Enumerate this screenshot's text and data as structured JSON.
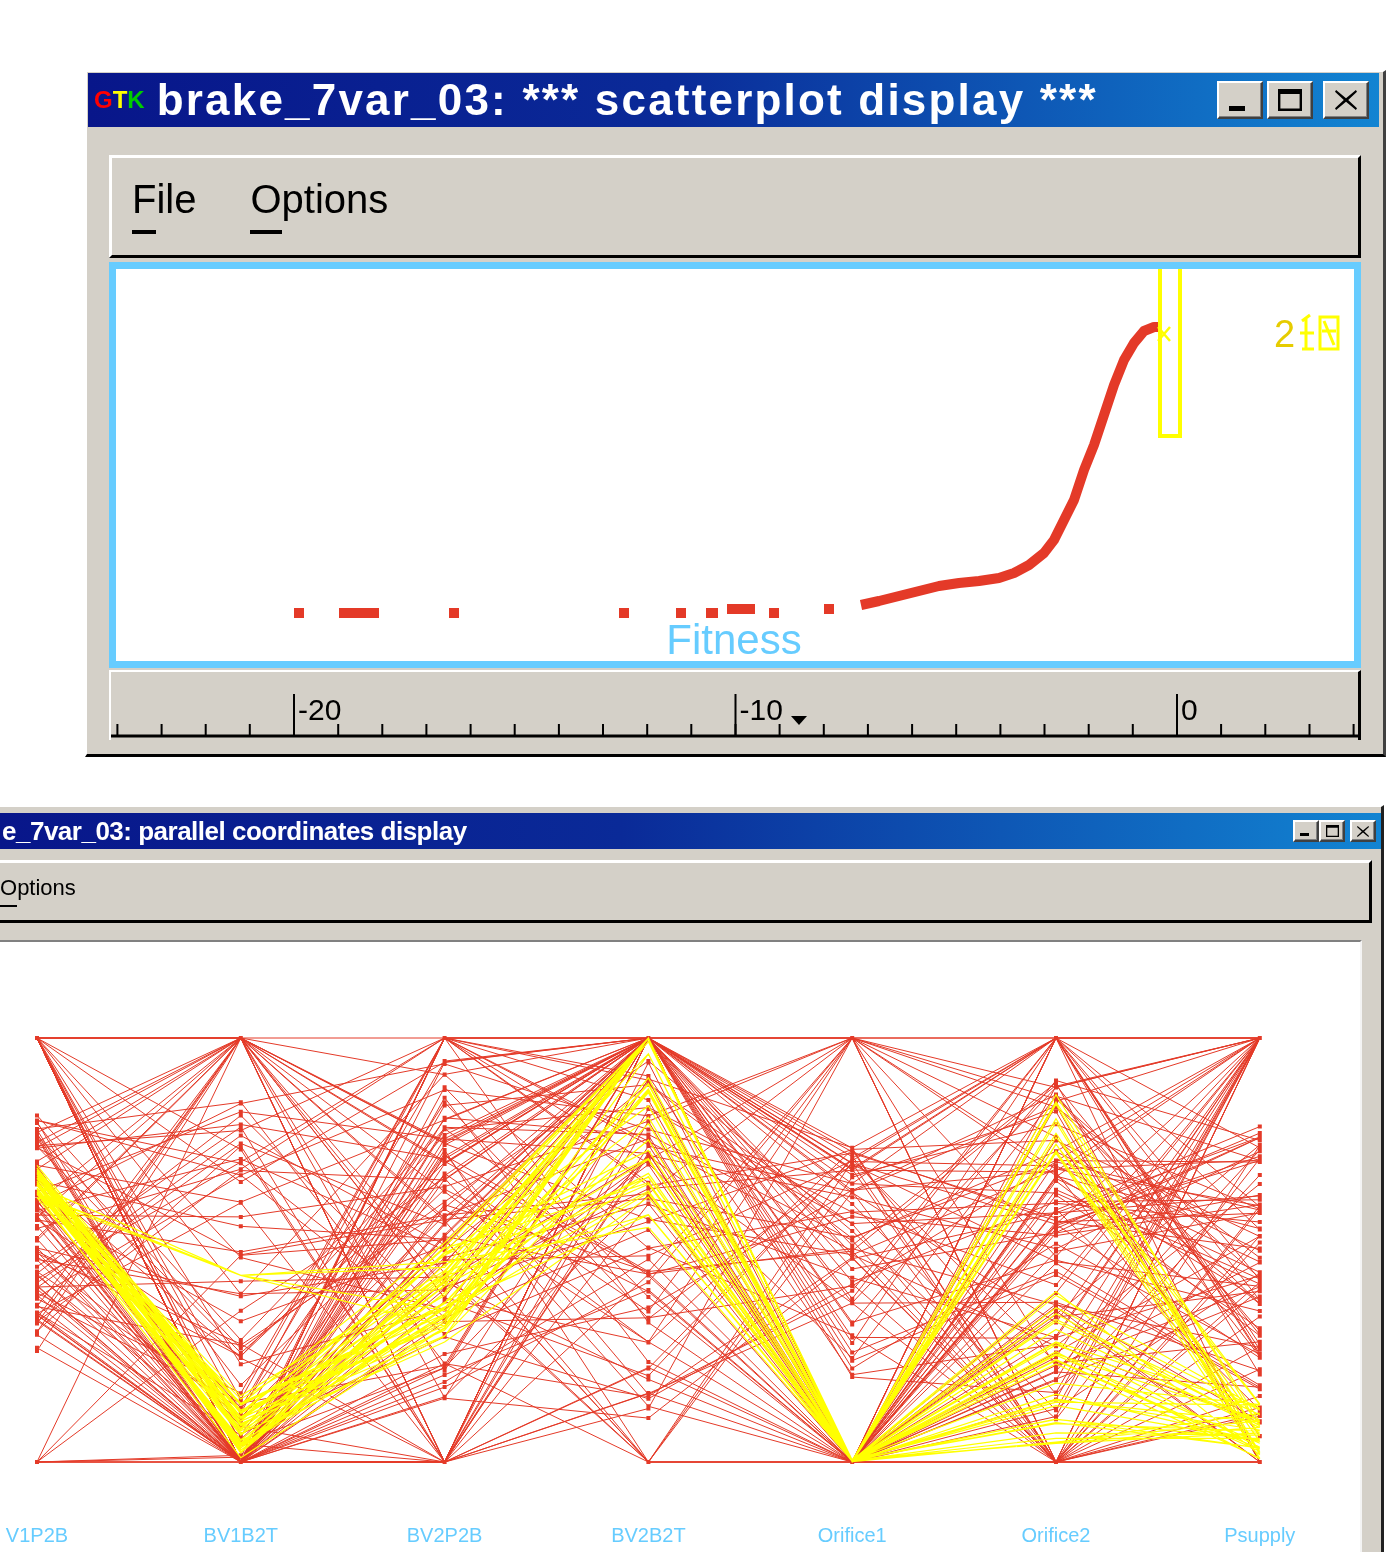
{
  "windows": [
    {
      "kind": "scatterplot",
      "title": "brake_7var_03: *** scatterplot display ***",
      "logo": [
        {
          "letter": "G",
          "color": "#ff0000"
        },
        {
          "letter": "T",
          "color": "#ffff00"
        },
        {
          "letter": "K",
          "color": "#00cc00"
        }
      ],
      "menu": [
        "File",
        "Options"
      ],
      "plot": {
        "variable": "Fitness",
        "point_label": "2",
        "ruler_labels": [
          "-20",
          "-10",
          "0"
        ]
      }
    },
    {
      "kind": "parallel_coordinates",
      "title": "e_7var_03: parallel coordinates display",
      "menu": [
        "Options"
      ],
      "plot": {
        "axes": [
          "V1P2B",
          "BV1B2T",
          "BV2P2B",
          "BV2B2T",
          "Orifice1",
          "Orifice2",
          "Psupply"
        ]
      }
    }
  ]
}
